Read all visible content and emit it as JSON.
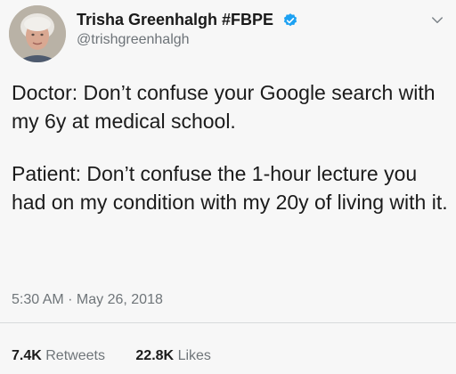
{
  "tweet": {
    "author": {
      "display_name": "Trisha Greenhalgh #FBPE",
      "handle": "@trishgreenhalgh",
      "verified_icon": "verified-badge-icon",
      "verified_color": "#1da1f2"
    },
    "menu_icon": "chevron-down-icon",
    "body": {
      "paragraph_1": "Doctor: Don’t confuse your Google search with my 6y at medical school.",
      "paragraph_2": "Patient: Don’t confuse the 1-hour lecture you had on my condition with my 20y of living with it."
    },
    "timestamp": "5:30 AM · May 26, 2018",
    "stats": {
      "retweets_count": "7.4K",
      "retweets_label": "Retweets",
      "likes_count": "22.8K",
      "likes_label": "Likes"
    }
  }
}
